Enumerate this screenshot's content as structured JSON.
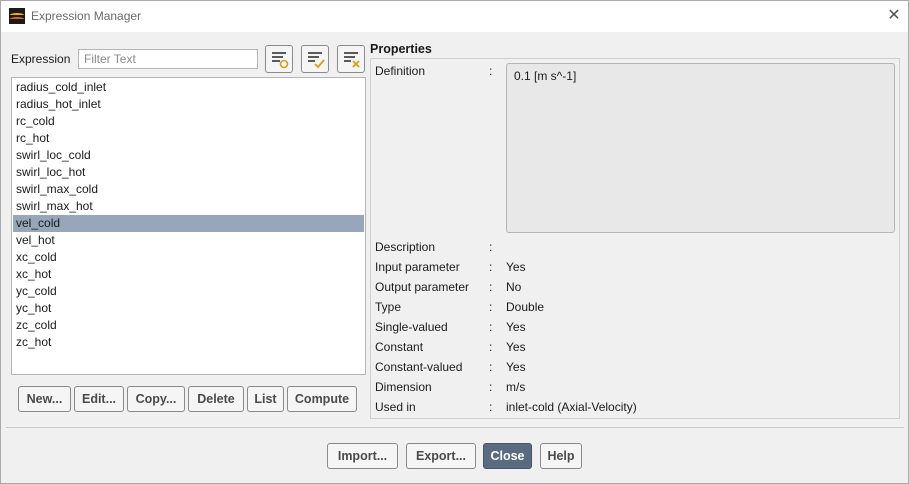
{
  "window": {
    "title": "Expression Manager",
    "close_glyph": "✕"
  },
  "filter": {
    "label": "Expression",
    "placeholder": "Filter Text",
    "value": ""
  },
  "toolbar_icons": [
    "filter-with-gear-icon",
    "filter-with-check-icon",
    "filter-with-clear-icon"
  ],
  "expressions": [
    "radius_cold_inlet",
    "radius_hot_inlet",
    "rc_cold",
    "rc_hot",
    "swirl_loc_cold",
    "swirl_loc_hot",
    "swirl_max_cold",
    "swirl_max_hot",
    "vel_cold",
    "vel_hot",
    "xc_cold",
    "xc_hot",
    "yc_cold",
    "yc_hot",
    "zc_cold",
    "zc_hot"
  ],
  "selected_expression": "vel_cold",
  "list_buttons": [
    "New...",
    "Edit...",
    "Copy...",
    "Delete",
    "List",
    "Compute"
  ],
  "properties": {
    "header": "Properties",
    "definition_label": "Definition",
    "definition_value": "0.1 [m s^-1]",
    "rows": [
      {
        "label": "Description",
        "value": ""
      },
      {
        "label": "Input parameter",
        "value": "Yes"
      },
      {
        "label": "Output parameter",
        "value": "No"
      },
      {
        "label": "Type",
        "value": "Double"
      },
      {
        "label": "Single-valued",
        "value": "Yes"
      },
      {
        "label": "Constant",
        "value": "Yes"
      },
      {
        "label": "Constant-valued",
        "value": "Yes"
      },
      {
        "label": "Dimension",
        "value": "m/s"
      },
      {
        "label": "Used in",
        "value": "inlet-cold (Axial-Velocity)"
      }
    ],
    "colon": ":"
  },
  "footer_buttons": [
    "Import...",
    "Export...",
    "Close",
    "Help"
  ],
  "colors": {
    "selection": "#97a6bb",
    "primary_button": "#5a6b80",
    "icon_accent": "#d4a017"
  }
}
